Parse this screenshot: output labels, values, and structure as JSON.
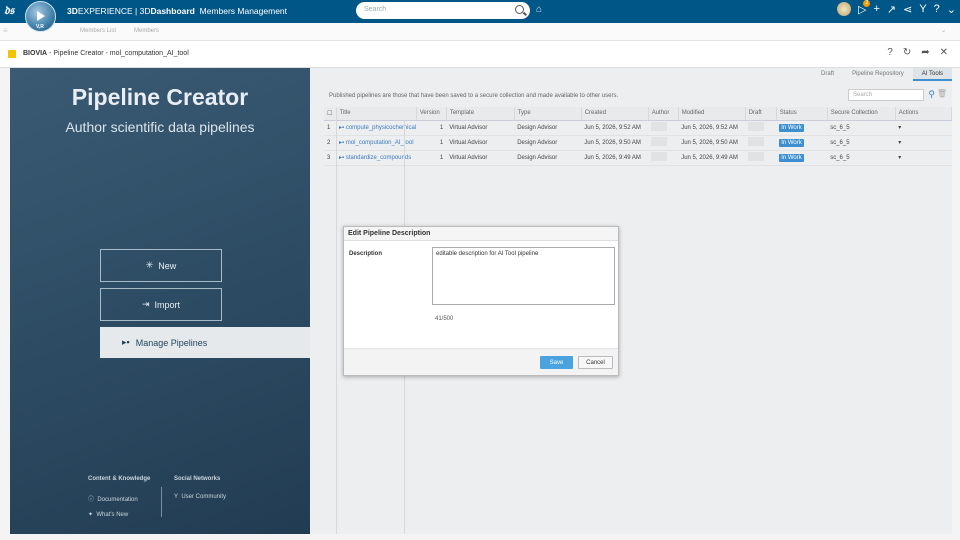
{
  "topbar": {
    "brand_3d": "3D",
    "brand_experience": "EXPERIENCE | 3D",
    "brand_dashboard": "Dashboard",
    "brand_app": "Members Management",
    "compass_label": "V,R",
    "search_placeholder": "Search",
    "notification_count": "2"
  },
  "subbar": {
    "items": [
      "Members List",
      "Members"
    ]
  },
  "app": {
    "brand": "BIOVIA",
    "title_rest": " - Pipeline Creator - mol_computation_AI_tool"
  },
  "left": {
    "title": "Pipeline Creator",
    "subtitle": "Author scientific data pipelines",
    "new_label": "New",
    "import_label": "Import",
    "manage_label": "Manage Pipelines",
    "footer": {
      "content_heading": "Content & Knowledge",
      "documentation": "Documentation",
      "whats_new": "What's New",
      "social_heading": "Social Networks",
      "user_community": "User Community"
    }
  },
  "right": {
    "tabs": [
      "Draft",
      "Pipeline Repository",
      "AI Tools"
    ],
    "active_tab": "AI Tools",
    "description": "Published pipelines are those that have been saved to a secure collection and made available to other users.",
    "filter_placeholder": "Search",
    "columns": [
      "Title",
      "Version",
      "Template",
      "Type",
      "Created",
      "Author",
      "Modified",
      "Draft",
      "Status",
      "Secure Collection",
      "Actions"
    ],
    "rows": [
      {
        "num": "1",
        "title": "compute_physicochemical",
        "version": "1",
        "template": "Virtual Advisor",
        "type": "Design Advisor",
        "created": "Jun 5, 2026, 9:52 AM",
        "modified": "Jun 5, 2026, 9:52 AM",
        "status": "In Work",
        "collection": "sc_6_5",
        "action": "▾"
      },
      {
        "num": "2",
        "title": "mol_computation_AI_tool",
        "version": "1",
        "template": "Virtual Advisor",
        "type": "Design Advisor",
        "created": "Jun 5, 2026, 9:50 AM",
        "modified": "Jun 5, 2026, 9:50 AM",
        "status": "In Work",
        "collection": "sc_6_5",
        "action": "▾"
      },
      {
        "num": "3",
        "title": "standardize_compounds",
        "version": "1",
        "template": "Virtual Advisor",
        "type": "Design Advisor",
        "created": "Jun 5, 2026, 9:49 AM",
        "modified": "Jun 5, 2026, 9:49 AM",
        "status": "In Work",
        "collection": "sc_6_5",
        "action": "▾"
      }
    ]
  },
  "dialog": {
    "title": "Edit Pipeline Description",
    "label": "Description",
    "value": "editable description for AI Tool pipeline",
    "counter": "41/500",
    "save": "Save",
    "cancel": "Cancel"
  }
}
